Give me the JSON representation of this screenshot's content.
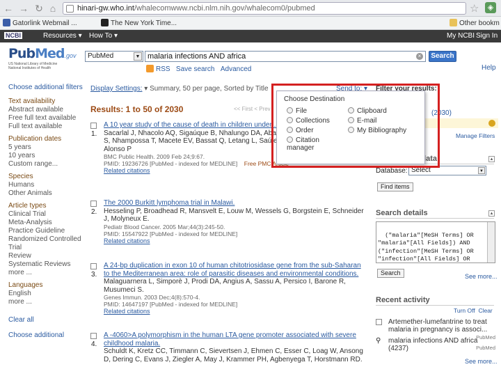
{
  "browser": {
    "url_domain": "hinari-gw.who.int",
    "url_path": "/whalecomwww.ncbi.nlm.nih.gov/whalecom0/pubmed",
    "bookmarks": [
      {
        "label": "Gatorlink Webmail ..."
      },
      {
        "label": "The New York Time..."
      }
    ],
    "other_bookmarks": "Other bookm"
  },
  "ncbi_bar": {
    "logo": "NCBI",
    "resources": "Resources",
    "howto": "How To",
    "my_ncbi": "My NCBI",
    "sign_in": "Sign In"
  },
  "header": {
    "logo_pub": "Pub",
    "logo_med": "Med",
    "logo_gov": ".gov",
    "logo_sub1": "US National Library of Medicine",
    "logo_sub2": "National Institutes of Health",
    "db_value": "PubMed",
    "search_value": "malaria infections AND africa",
    "search_button": "Search",
    "rss": "RSS",
    "save_search": "Save search",
    "advanced": "Advanced",
    "help": "Help"
  },
  "sidebar": {
    "choose_filters": "Choose additional filters",
    "groups": [
      {
        "title": "Text availability",
        "options": [
          "Abstract available",
          "Free full text available",
          "Full text available"
        ]
      },
      {
        "title": "Publication dates",
        "options": [
          "5 years",
          "10 years",
          "Custom range..."
        ]
      },
      {
        "title": "Species",
        "options": [
          "Humans",
          "Other Animals"
        ]
      },
      {
        "title": "Article types",
        "options": [
          "Clinical Trial",
          "Meta-Analysis",
          "Practice Guideline",
          "Randomized Controlled Trial",
          "Review",
          "Systematic Reviews",
          "more ..."
        ]
      },
      {
        "title": "Languages",
        "options": [
          "English",
          "more ..."
        ]
      }
    ],
    "clear_all": "Clear all",
    "choose_additional": "Choose additional"
  },
  "results_header": {
    "display_settings": "Display Settings:",
    "summary": "Summary, 50 per page, Sorted by Title",
    "send_to": "Send to:",
    "results_title": "Results: 1 to 50 of 2030",
    "pager": "<< First  < Prev"
  },
  "results": [
    {
      "num": "1.",
      "title": "A 10 year study of the cause of death in children under ... Mozambique.",
      "authors": "Sacarlal J, Nhacolo AQ, Sigaúque B, Nhalungo DA, Abacassamo F, Aide P, Machevo S, Nhampossa T, Macete EV, Bassat Q, Letang L, Saúte F, Aponte JJ, Thompson R, Alonso P",
      "journal": "BMC Public Health. 2009 Feb 24;9:67.",
      "pmid": "PMID: 19236726 [PubMed - indexed for MEDLINE]",
      "free": "Free PMC Article",
      "related": "Related citations"
    },
    {
      "num": "2.",
      "title": "The 2000 Burkitt lymphoma trial in Malawi.",
      "authors": "Hesseling P, Broadhead R, Mansvelt E, Louw M, Wessels G, Borgstein E, Schneider J, Molyneux E.",
      "journal": "Pediatr Blood Cancer. 2005 Mar;44(3):245-50.",
      "pmid": "PMID: 15547922 [PubMed - indexed for MEDLINE]",
      "free": "",
      "related": "Related citations"
    },
    {
      "num": "3.",
      "title": "A 24-bp duplication in exon 10 of human chitotriosidase gene from the sub-Saharan to the Mediterranean area: role of parasitic diseases and environmental conditions.",
      "authors": "Malaguarnera L, Simporè J, Prodi DA, Angius A, Sassu A, Persico I, Barone R, Musumeci S.",
      "journal": "Genes Immun. 2003 Dec;4(8):570-4.",
      "pmid": "PMID: 14647197 [PubMed - indexed for MEDLINE]",
      "free": "",
      "related": "Related citations"
    },
    {
      "num": "4.",
      "title": "A -4060>A polymorphism in the human LTA gene promoter associated with severe childhood malaria.",
      "authors": "Schuldt K, Kretz CC, Timmann C, Sievertsen J, Ehmen C, Esser C, Loag W, Ansong D, Dering C, Evans J, Ziegler A, May J, Krammer PH, Agbenyega T, Horstmann RD.",
      "journal": "",
      "pmid": "",
      "free": "",
      "related": ""
    }
  ],
  "send_to_menu": {
    "title": "Choose Destination",
    "options": [
      "File",
      "Clipboard",
      "Collections",
      "E-mail",
      "Order",
      "My Bibliography",
      "Citation manager"
    ]
  },
  "right": {
    "filter_title": "Filter your results:",
    "filter_count": "(2030)",
    "manage_filters": "Manage Filters",
    "related_title": "Find related data",
    "database_label": "Database:",
    "database_value": "Select",
    "find_items": "Find items",
    "details_title": "Search details",
    "details_text": "(\"malaria\"[MeSH Terms] OR\n\"malaria\"[All Fields]) AND\n(\"infection\"[MeSH Terms] OR\n\"infection\"[All Fields] OR\n\"infections\"[All Fields])",
    "details_search": "Search",
    "see_more": "See more...",
    "recent_title": "Recent activity",
    "turn_off": "Turn Off",
    "clear": "Clear",
    "recent_items": [
      {
        "text": "Artemether-lumefantrine to treat malaria in pregnancy is associ...",
        "db": "PubMed"
      },
      {
        "text": "malaria infections AND africa (4237)",
        "db": "PubMed"
      }
    ]
  },
  "colors": {
    "highlight_box": "#d42020",
    "link": "#2a5aa0",
    "results_title": "#9c4a14"
  }
}
